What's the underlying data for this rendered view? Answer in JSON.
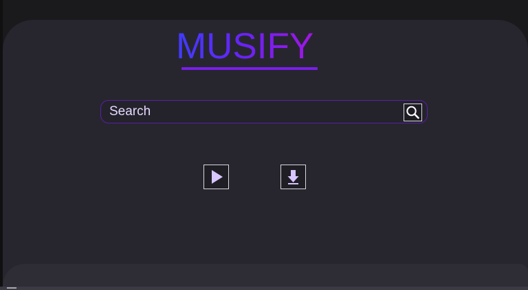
{
  "app": {
    "logo_text": "MUSIFY"
  },
  "search": {
    "placeholder": "Search",
    "value": "",
    "button_icon": "search-icon"
  },
  "controls": {
    "play_icon": "play-icon",
    "download_icon": "download-icon"
  },
  "colors": {
    "page_background": "#1a1a1d",
    "panel_background": "#27262f",
    "logo_gradient_start": "#3f3cff",
    "logo_gradient_end": "#a016e4",
    "accent": "#7b1de8",
    "search_border": "#5a1fa6",
    "icon_fill": "#d7c6ff",
    "text": "#e6d8ff"
  }
}
